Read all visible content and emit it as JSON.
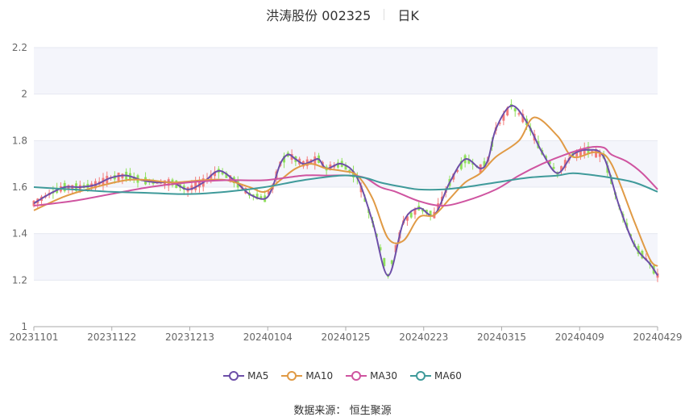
{
  "header": {
    "name": "洪涛股份 002325",
    "period": "日K"
  },
  "source": {
    "label": "数据来源：",
    "value": "恒生聚源"
  },
  "chart_data": {
    "type": "candlestick",
    "y_ticks": [
      "1",
      "1.2",
      "1.4",
      "1.6",
      "1.8",
      "2",
      "2.2"
    ],
    "ylim": [
      1,
      2.2
    ],
    "x_labels": [
      "20231101",
      "20231122",
      "20231213",
      "20240104",
      "20240125",
      "20240223",
      "20240315",
      "20240409",
      "20240429"
    ],
    "colors": {
      "up": "#f37b7b",
      "down": "#8fe05b",
      "ma5": "#6d4fa8",
      "ma10": "#e09a45",
      "ma30": "#cf54a0",
      "ma60": "#3f9a9a"
    },
    "series": [
      {
        "name": "MA5",
        "color": "#6d4fa8",
        "x": [
          0,
          4,
          8,
          12,
          16,
          20,
          24,
          28,
          32,
          36,
          40,
          44,
          48,
          52,
          56,
          60,
          62,
          64,
          66,
          68,
          70,
          72,
          74,
          76,
          80,
          84,
          88,
          92,
          96,
          100,
          104,
          108,
          112,
          116,
          118,
          120,
          124,
          128,
          132,
          136,
          140,
          144,
          148,
          152,
          156,
          160,
          162
        ],
        "y": [
          1.53,
          1.57,
          1.6,
          1.6,
          1.61,
          1.64,
          1.65,
          1.63,
          1.62,
          1.62,
          1.59,
          1.62,
          1.67,
          1.63,
          1.57,
          1.55,
          1.6,
          1.7,
          1.74,
          1.72,
          1.7,
          1.71,
          1.72,
          1.68,
          1.7,
          1.64,
          1.45,
          1.22,
          1.45,
          1.51,
          1.48,
          1.62,
          1.72,
          1.68,
          1.72,
          1.85,
          1.95,
          1.88,
          1.75,
          1.66,
          1.74,
          1.76,
          1.73,
          1.52,
          1.35,
          1.27,
          1.22
        ]
      },
      {
        "name": "MA10",
        "color": "#e09a45",
        "x": [
          0,
          8,
          16,
          24,
          30,
          36,
          44,
          50,
          56,
          60,
          64,
          68,
          72,
          76,
          80,
          84,
          88,
          92,
          96,
          100,
          104,
          108,
          112,
          116,
          120,
          126,
          130,
          136,
          140,
          146,
          150,
          156,
          160,
          162
        ],
        "y": [
          1.5,
          1.56,
          1.6,
          1.63,
          1.63,
          1.62,
          1.63,
          1.63,
          1.6,
          1.58,
          1.63,
          1.68,
          1.7,
          1.68,
          1.67,
          1.65,
          1.55,
          1.38,
          1.37,
          1.47,
          1.48,
          1.55,
          1.62,
          1.66,
          1.73,
          1.8,
          1.9,
          1.82,
          1.73,
          1.75,
          1.7,
          1.45,
          1.29,
          1.26
        ]
      },
      {
        "name": "MA30",
        "color": "#cf54a0",
        "x": [
          0,
          10,
          20,
          30,
          40,
          50,
          60,
          70,
          76,
          82,
          86,
          90,
          94,
          100,
          106,
          112,
          120,
          126,
          132,
          138,
          144,
          148,
          150,
          154,
          158,
          162
        ],
        "y": [
          1.52,
          1.54,
          1.57,
          1.6,
          1.62,
          1.63,
          1.63,
          1.65,
          1.65,
          1.65,
          1.64,
          1.6,
          1.58,
          1.54,
          1.52,
          1.54,
          1.59,
          1.65,
          1.7,
          1.74,
          1.77,
          1.77,
          1.74,
          1.71,
          1.66,
          1.59
        ]
      },
      {
        "name": "MA60",
        "color": "#3f9a9a",
        "x": [
          0,
          10,
          20,
          30,
          40,
          50,
          60,
          70,
          80,
          86,
          90,
          96,
          100,
          106,
          112,
          120,
          128,
          136,
          140,
          146,
          150,
          156,
          162
        ],
        "y": [
          1.6,
          1.59,
          1.58,
          1.575,
          1.57,
          1.58,
          1.6,
          1.63,
          1.65,
          1.64,
          1.62,
          1.6,
          1.59,
          1.59,
          1.6,
          1.62,
          1.64,
          1.65,
          1.66,
          1.65,
          1.64,
          1.62,
          1.58
        ]
      }
    ]
  }
}
